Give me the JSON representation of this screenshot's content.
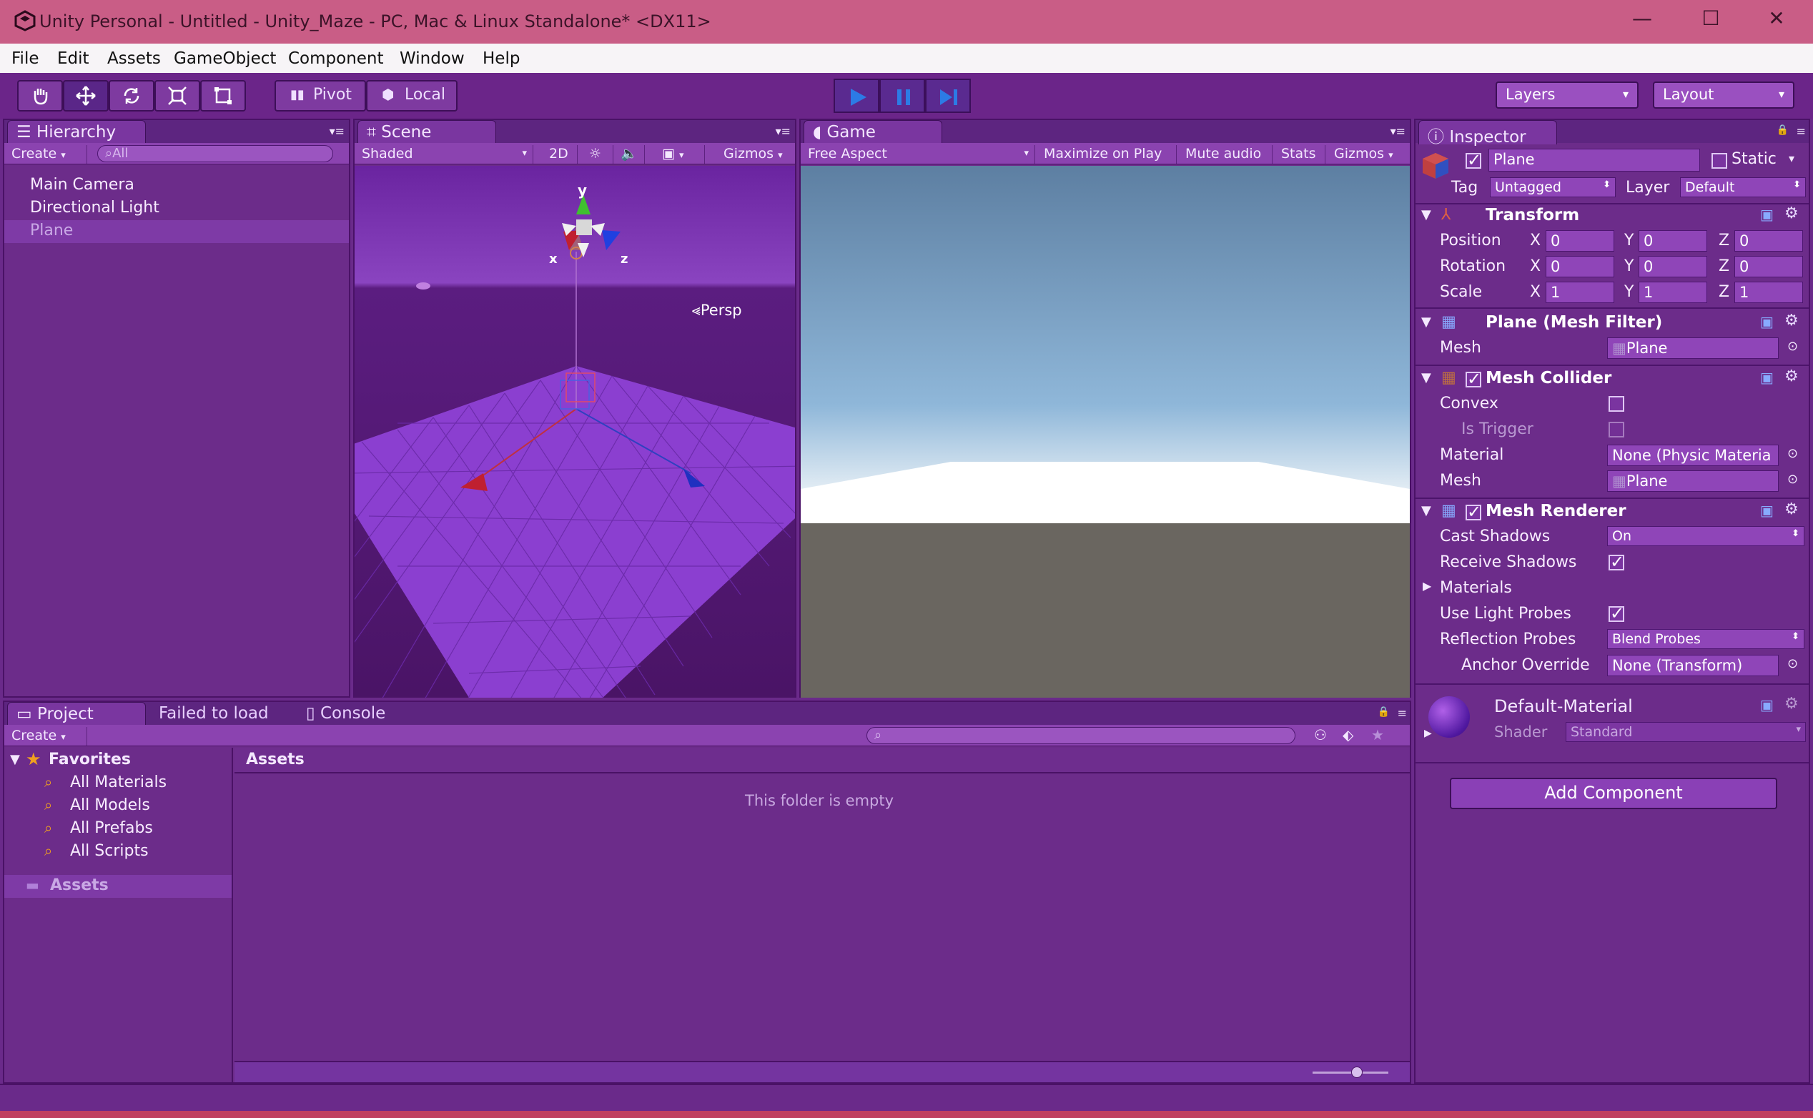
{
  "window": {
    "title": "Unity Personal - Untitled - Unity_Maze - PC, Mac & Linux Standalone* <DX11>",
    "controls": [
      "—",
      "☐",
      "✕"
    ]
  },
  "menu": [
    "File",
    "Edit",
    "Assets",
    "GameObject",
    "Component",
    "Window",
    "Help"
  ],
  "toolbar": {
    "pivot": "Pivot",
    "local": "Local",
    "layers": "Layers",
    "layout": "Layout"
  },
  "hierarchy": {
    "tab": "Hierarchy",
    "create": "Create",
    "search_placeholder": "All",
    "items": [
      "Main Camera",
      "Directional Light",
      "Plane"
    ]
  },
  "scene": {
    "tab": "Scene",
    "shading": "Shaded",
    "mode2d": "2D",
    "gizmos": "Gizmos",
    "persp": "Persp",
    "axis_y": "y",
    "axis_x": "x",
    "axis_z": "z"
  },
  "game": {
    "tab": "Game",
    "aspect": "Free Aspect",
    "maximize": "Maximize on Play",
    "mute": "Mute audio",
    "stats": "Stats",
    "gizmos": "Gizmos"
  },
  "project": {
    "tabs": [
      "Project",
      "Failed to load",
      "Console"
    ],
    "create": "Create",
    "favorites_label": "Favorites",
    "favorites": [
      "All Materials",
      "All Models",
      "All Prefabs",
      "All Scripts"
    ],
    "assets_label": "Assets",
    "assets_header": "Assets",
    "empty_message": "This folder is empty"
  },
  "inspector": {
    "tab": "Inspector",
    "object_name": "Plane",
    "static_label": "Static",
    "tag_label": "Tag",
    "tag_value": "Untagged",
    "layer_label": "Layer",
    "layer_value": "Default",
    "transform": {
      "title": "Transform",
      "rows": [
        {
          "label": "Position",
          "x": "0",
          "y": "0",
          "z": "0"
        },
        {
          "label": "Rotation",
          "x": "0",
          "y": "0",
          "z": "0"
        },
        {
          "label": "Scale",
          "x": "1",
          "y": "1",
          "z": "1"
        }
      ],
      "x_label": "X",
      "y_label": "Y",
      "z_label": "Z"
    },
    "mesh_filter": {
      "title": "Plane (Mesh Filter)",
      "mesh_label": "Mesh",
      "mesh_value": "Plane"
    },
    "mesh_collider": {
      "title": "Mesh Collider",
      "convex": "Convex",
      "is_trigger": "Is Trigger",
      "material_label": "Material",
      "material_value": "None (Physic Materia",
      "mesh_label": "Mesh",
      "mesh_value": "Plane"
    },
    "mesh_renderer": {
      "title": "Mesh Renderer",
      "cast_shadows": "Cast Shadows",
      "cast_shadows_value": "On",
      "receive_shadows": "Receive Shadows",
      "materials": "Materials",
      "use_light_probes": "Use Light Probes",
      "reflection_probes": "Reflection Probes",
      "reflection_probes_value": "Blend Probes",
      "anchor_override": "Anchor Override",
      "anchor_override_value": "None (Transform)"
    },
    "material": {
      "name": "Default-Material",
      "shader_label": "Shader",
      "shader_value": "Standard"
    },
    "add_component": "Add Component"
  }
}
